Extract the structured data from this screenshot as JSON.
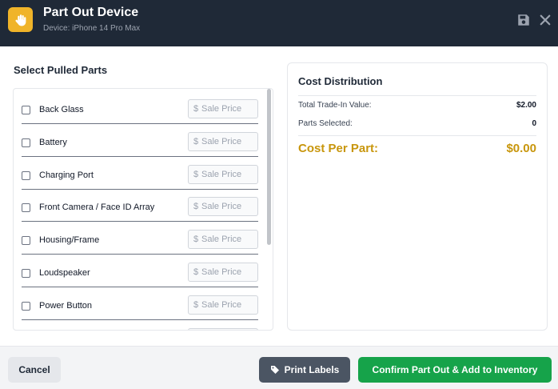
{
  "header": {
    "icon": "hand-icon",
    "title": "Part Out Device",
    "subtitle": "Device: iPhone 14 Pro Max",
    "save_icon": "save-icon",
    "close_icon": "close-icon"
  },
  "parts": {
    "title": "Select Pulled Parts",
    "currency_symbol": "$",
    "price_placeholder": "Sale Price",
    "items": [
      {
        "label": "Back Glass",
        "checked": false
      },
      {
        "label": "Battery",
        "checked": false
      },
      {
        "label": "Charging Port",
        "checked": false
      },
      {
        "label": "Front Camera / Face ID Array",
        "checked": false
      },
      {
        "label": "Housing/Frame",
        "checked": false
      },
      {
        "label": "Loudspeaker",
        "checked": false
      },
      {
        "label": "Power Button",
        "checked": false
      }
    ]
  },
  "cost": {
    "title": "Cost Distribution",
    "trade_in_label": "Total Trade-In Value:",
    "trade_in_value": "$2.00",
    "parts_selected_label": "Parts Selected:",
    "parts_selected_value": "0",
    "cost_per_part_label": "Cost Per Part:",
    "cost_per_part_value": "$0.00"
  },
  "footer": {
    "cancel_label": "Cancel",
    "print_label": "Print Labels",
    "print_icon": "tag-icon",
    "confirm_label": "Confirm Part Out & Add to Inventory"
  },
  "colors": {
    "header_bg": "#1f2937",
    "accent": "#f0b429",
    "cost_highlight": "#c8960c",
    "confirm_green": "#16a34a",
    "print_gray": "#4b5563"
  }
}
